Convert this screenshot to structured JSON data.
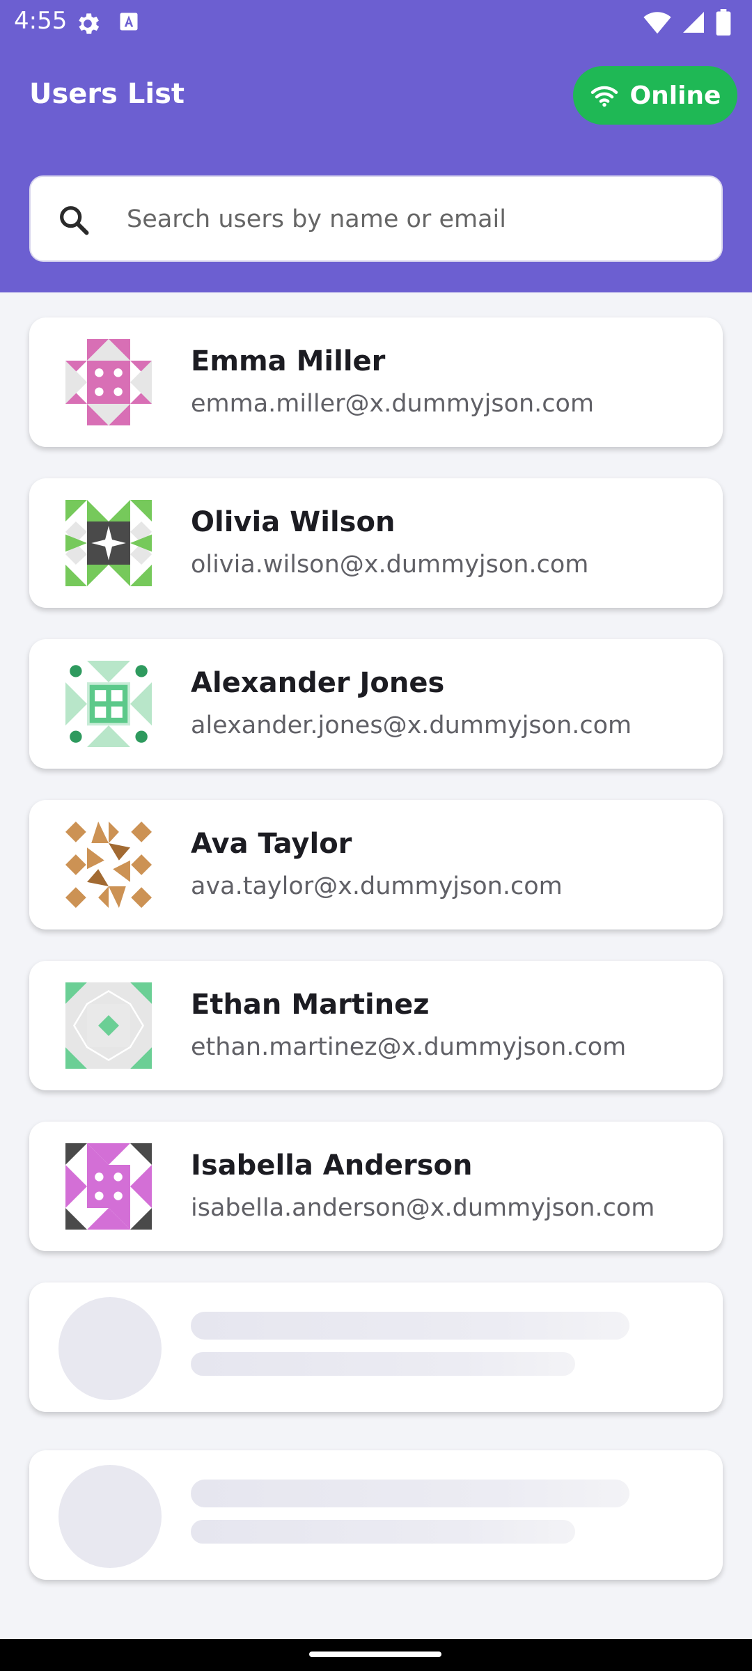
{
  "status_bar": {
    "time": "4:55",
    "icons": [
      "gear-icon",
      "a-badge-icon",
      "wifi-icon",
      "signal-icon",
      "battery-icon"
    ]
  },
  "app_bar": {
    "title": "Users List",
    "status_label": "Online",
    "status_icon": "wifi-icon",
    "colors": {
      "background": "#6c5fd1",
      "online": "#1fb855"
    }
  },
  "search": {
    "placeholder": "Search users by name or email",
    "value": "",
    "icon": "search-icon"
  },
  "users": [
    {
      "name": "Emma Miller",
      "email": "emma.miller@x.dummyjson.com",
      "avatar": "identicon-pink"
    },
    {
      "name": "Olivia Wilson",
      "email": "olivia.wilson@x.dummyjson.com",
      "avatar": "identicon-green-dark"
    },
    {
      "name": "Alexander Jones",
      "email": "alexander.jones@x.dummyjson.com",
      "avatar": "identicon-teal"
    },
    {
      "name": "Ava Taylor",
      "email": "ava.taylor@x.dummyjson.com",
      "avatar": "identicon-tan"
    },
    {
      "name": "Ethan Martinez",
      "email": "ethan.martinez@x.dummyjson.com",
      "avatar": "identicon-mint"
    },
    {
      "name": "Isabella Anderson",
      "email": "isabella.anderson@x.dummyjson.com",
      "avatar": "identicon-violet"
    }
  ],
  "loading_placeholders": 2
}
